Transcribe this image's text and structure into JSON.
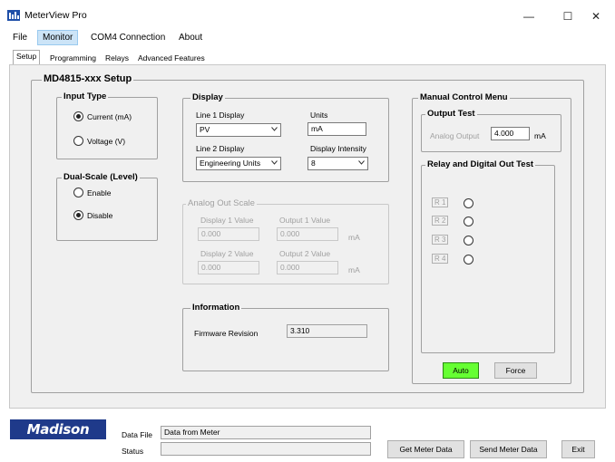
{
  "window": {
    "title": "MeterView Pro",
    "controls": {
      "minimize": "—",
      "maximize": "☐",
      "close": "✕"
    }
  },
  "menu": {
    "items": [
      "File",
      "Monitor",
      "COM4 Connection",
      "About"
    ],
    "active": "Monitor"
  },
  "tabs": [
    "Setup",
    "Programming",
    "Relays",
    "Advanced Features"
  ],
  "setup": {
    "title": "MD4815-xxx Setup",
    "input_type": {
      "title": "Input Type",
      "options": [
        "Current (mA)",
        "Voltage (V)"
      ],
      "selected": "Current (mA)"
    },
    "dual_scale": {
      "title": "Dual-Scale (Level)",
      "options": [
        "Enable",
        "Disable"
      ],
      "selected": "Disable"
    },
    "display": {
      "title": "Display",
      "line1_label": "Line 1 Display",
      "line1_value": "PV",
      "units_label": "Units",
      "units_value": "mA",
      "line2_label": "Line 2 Display",
      "line2_value": "Engineering Units",
      "intensity_label": "Display Intensity",
      "intensity_value": "8"
    },
    "analog_out": {
      "title": "Analog Out Scale",
      "display1_label": "Display 1 Value",
      "display1_value": "0.000",
      "output1_label": "Output 1 Value",
      "output1_value": "0.000",
      "display2_label": "Display 2 Value",
      "display2_value": "0.000",
      "output2_label": "Output 2 Value",
      "output2_value": "0.000",
      "unit": "mA"
    },
    "information": {
      "title": "Information",
      "firmware_label": "Firmware Revision",
      "firmware_value": "3.310"
    },
    "manual_control": {
      "title": "Manual Control Menu",
      "output_test": {
        "title": "Output Test",
        "analog_label": "Analog Output",
        "analog_value": "4.000",
        "unit": "mA"
      },
      "relay_test": {
        "title": "Relay and Digital Out Test",
        "relays": [
          "R 1",
          "R 2",
          "R 3",
          "R 4"
        ]
      },
      "auto_label": "Auto",
      "force_label": "Force"
    }
  },
  "footer": {
    "logo": "Madison",
    "data_file_label": "Data File",
    "data_file_value": "Data from Meter",
    "status_label": "Status",
    "status_value": "",
    "get_button": "Get Meter Data",
    "send_button": "Send Meter Data",
    "exit_button": "Exit"
  },
  "colors": {
    "auto_button": "#66ff33",
    "logo_background": "#1f3a8a",
    "active_menu": "#cce4f7"
  }
}
